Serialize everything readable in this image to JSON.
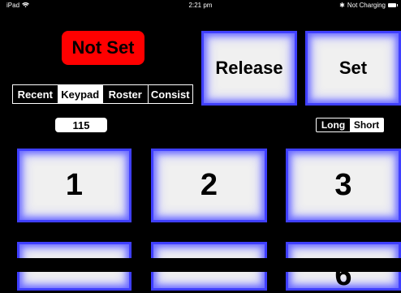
{
  "status_bar": {
    "device": "iPad",
    "time": "2:21 pm",
    "battery_text": "Not Charging"
  },
  "status_indicator": {
    "label": "Not Set",
    "color": "#ff0000"
  },
  "actions": {
    "release_label": "Release",
    "set_label": "Set"
  },
  "tabs": [
    {
      "label": "Recent",
      "selected": false
    },
    {
      "label": "Keypad",
      "selected": true
    },
    {
      "label": "Roster",
      "selected": false
    },
    {
      "label": "Consist",
      "selected": false
    }
  ],
  "address_value": "115",
  "address_type": [
    {
      "label": "Long",
      "selected": false
    },
    {
      "label": "Short",
      "selected": true
    }
  ],
  "keypad": [
    "1",
    "2",
    "3",
    "",
    "",
    "6"
  ],
  "colors": {
    "key_glow": "#3f3fff",
    "key_face": "#f0f0f0"
  }
}
